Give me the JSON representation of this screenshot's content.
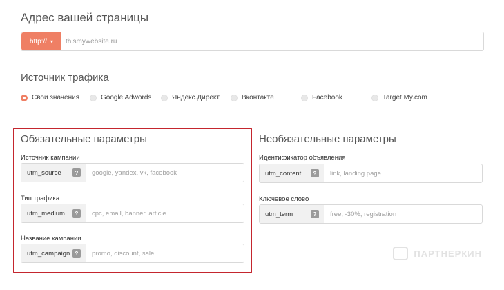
{
  "page_address": {
    "title": "Адрес вашей страницы",
    "protocol_label": "http://",
    "url_placeholder": "thismywebsite.ru"
  },
  "traffic_source": {
    "title": "Источник трафика",
    "options": [
      {
        "label": "Свои значения",
        "selected": true
      },
      {
        "label": "Google Adwords",
        "selected": false
      },
      {
        "label": "Яндекс.Директ",
        "selected": false
      },
      {
        "label": "Вконтакте",
        "selected": false
      },
      {
        "label": "Facebook",
        "selected": false
      },
      {
        "label": "Target My.com",
        "selected": false
      }
    ]
  },
  "required": {
    "title": "Обязательные параметры",
    "fields": [
      {
        "label": "Источник кампании",
        "key": "utm_source",
        "placeholder": "google, yandex, vk, facebook"
      },
      {
        "label": "Тип трафика",
        "key": "utm_medium",
        "placeholder": "cpc, email, banner, article"
      },
      {
        "label": "Название кампании",
        "key": "utm_campaign",
        "placeholder": "promo, discount, sale"
      }
    ]
  },
  "optional": {
    "title": "Необязательные параметры",
    "fields": [
      {
        "label": "Идентификатор объявления",
        "key": "utm_content",
        "placeholder": "link, landing page"
      },
      {
        "label": "Ключевое слово",
        "key": "utm_term",
        "placeholder": "free, -30%, registration"
      }
    ]
  },
  "help_glyph": "?",
  "watermark": "ПАРТНЕРКИН",
  "colors": {
    "accent": "#ef7f64",
    "highlight_border": "#c4262e"
  }
}
